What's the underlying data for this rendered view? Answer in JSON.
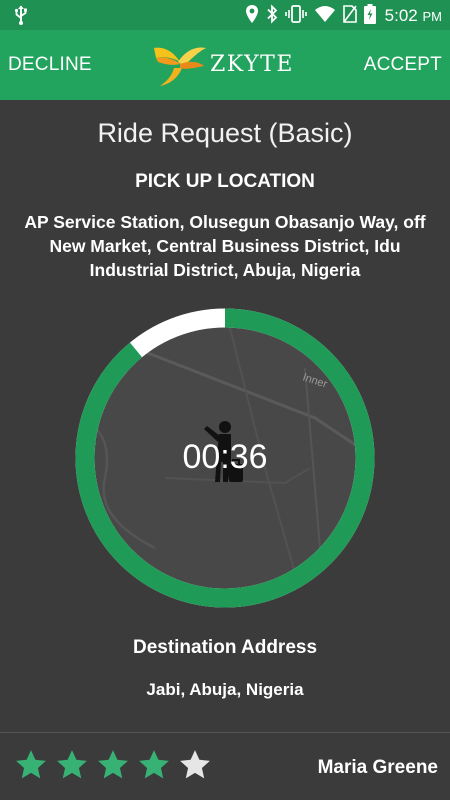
{
  "status_bar": {
    "time": "5:02",
    "ampm": "PM",
    "icons": [
      "usb-icon",
      "location-icon",
      "bluetooth-icon",
      "vibrate-icon",
      "wifi-icon",
      "no-sim-icon",
      "battery-charging-icon"
    ]
  },
  "app_bar": {
    "decline_label": "DECLINE",
    "accept_label": "ACCEPT",
    "brand_name": "ZKYTE",
    "primary_color": "#22a35e",
    "status_color": "#1f9153"
  },
  "request": {
    "title": "Ride Request (Basic)",
    "pickup_heading": "PICK UP LOCATION",
    "pickup_address": "AP Service Station, Olusegun Obasanjo Way, off New Market, Central Business District, Idu Industrial District, Abuja, Nigeria",
    "destination_heading": "Destination Address",
    "destination_address": "Jabi, Abuja, Nigeria"
  },
  "timer": {
    "countdown": "00:36",
    "remaining_fraction": 0.89,
    "map_label": "Inner",
    "ring_color": "#1f9a57",
    "elapsed_color": "#ffffff"
  },
  "rider": {
    "name": "Maria Greene",
    "rating": 4,
    "max_rating": 5,
    "star_filled_color": "#38b274",
    "star_empty_color": "#e6e6e6"
  }
}
